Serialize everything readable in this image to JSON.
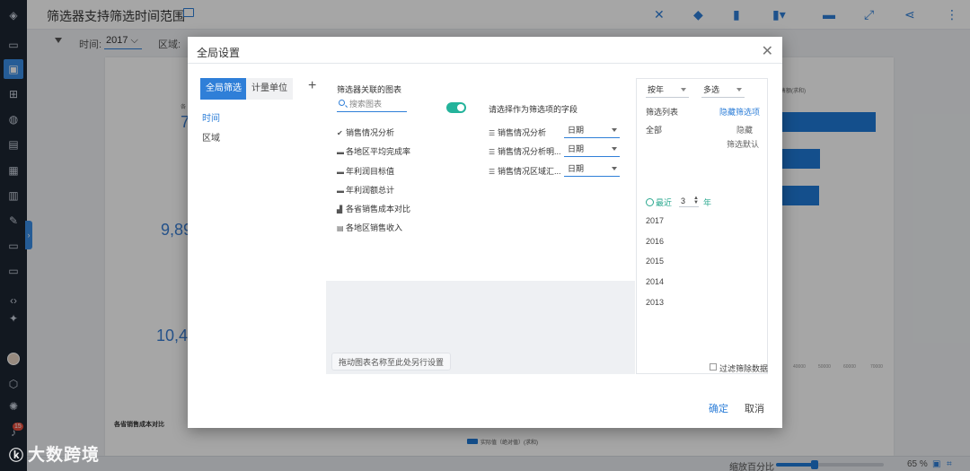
{
  "header": {
    "title": "筛选器支持筛选时间范围",
    "icons": [
      "magic-icon",
      "shapes-icon",
      "bar-chart-icon",
      "chart-menu-icon",
      "table-icon",
      "fullscreen-icon",
      "share-icon",
      "more-icon"
    ]
  },
  "filterbar": {
    "time_label": "时间:",
    "time_value": "2017",
    "region_label": "区域:"
  },
  "report": {
    "num1": "7",
    "num2": "9,89",
    "num3": "10,4",
    "chart2_title": "各省销售成本对比",
    "legend": "实际值（绝对值）(求和)",
    "ticks": [
      "40000",
      "50000",
      "60000",
      "70000"
    ],
    "corner_label1": "各",
    "corner_label2": "售额(求和)"
  },
  "dialog": {
    "title": "全局设置",
    "tabs": [
      "全局筛选",
      "计量单位"
    ],
    "left_items": [
      "时间",
      "区域"
    ],
    "mid": {
      "header": "筛选器关联的图表",
      "search_placeholder": "搜索图表",
      "field_header": "请选择作为筛选项的字段",
      "charts": [
        "销售情况分析",
        "各地区平均完成率",
        "年利润目标值",
        "年利润额总计",
        "各省销售成本对比",
        "各地区销售收入"
      ],
      "linked": [
        {
          "name": "销售情况分析",
          "field": "日期"
        },
        {
          "name": "销售情况分析明...",
          "field": "日期"
        },
        {
          "name": "销售情况区域汇...",
          "field": "日期"
        }
      ],
      "drag_hint": "拖动图表名称至此处另行设置"
    },
    "right": {
      "granularity": "按年",
      "mode": "多选",
      "list_label": "筛选列表",
      "hide_link": "隐藏筛选项",
      "all": "全部",
      "hide": "隐藏",
      "default": "筛选默认",
      "recent_label": "最近",
      "recent_value": "3",
      "recent_unit": "年",
      "years": [
        "2017",
        "2016",
        "2015",
        "2014",
        "2013"
      ],
      "filter_empty": "过滤筛除数据"
    },
    "ok": "确定",
    "cancel": "取消"
  },
  "bottombar": {
    "zoom_label": "缩放百分比",
    "zoom_value": "65 %",
    "zoom_fraction": 0.65
  },
  "watermark": "大数跨境",
  "rail": {
    "badge": "15"
  }
}
